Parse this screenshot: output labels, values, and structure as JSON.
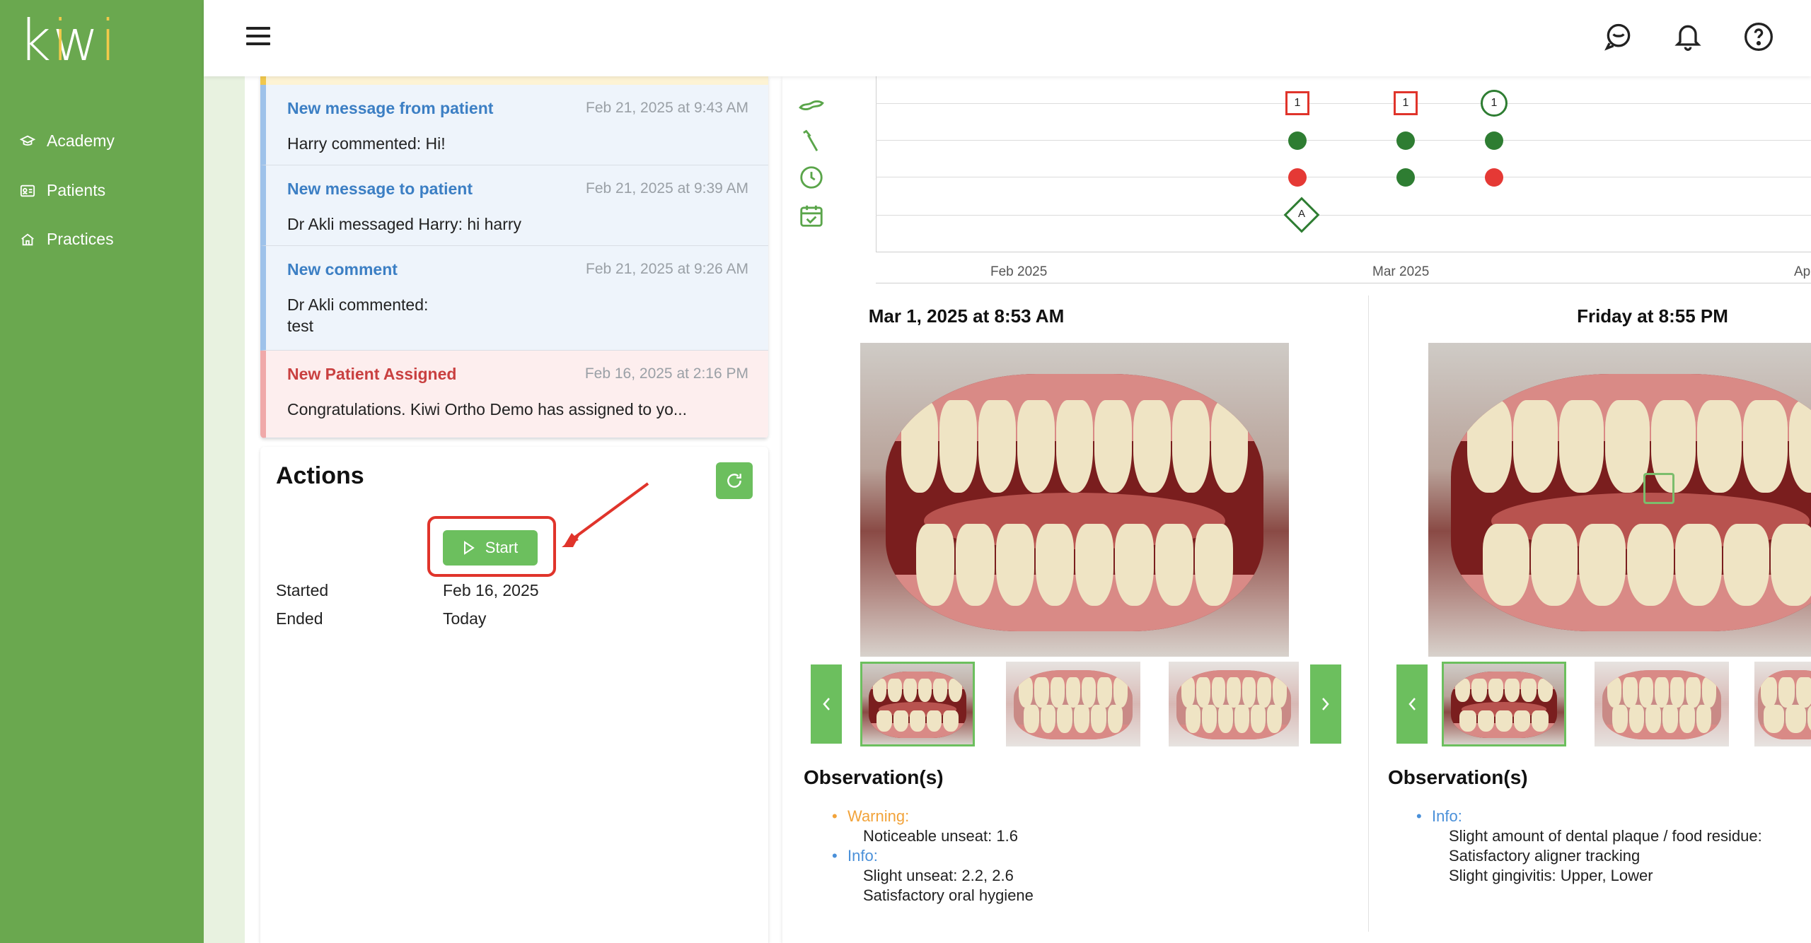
{
  "brand": {
    "logo_text": "kiwi"
  },
  "sidebar": {
    "items": [
      {
        "label": "Academy",
        "icon": "graduation-cap-icon"
      },
      {
        "label": "Patients",
        "icon": "id-card-icon"
      },
      {
        "label": "Practices",
        "icon": "home-icon"
      }
    ]
  },
  "topbar": {
    "icons": [
      "chat-icon",
      "bell-icon",
      "help-icon"
    ]
  },
  "notifications": [
    {
      "title": "New message from patient",
      "time": "Feb 21, 2025 at 9:43 AM",
      "body": "Harry commented: Hi!",
      "type": "blue"
    },
    {
      "title": "New message to patient",
      "time": "Feb 21, 2025 at 9:39 AM",
      "body": "Dr Akli messaged Harry: hi harry",
      "type": "blue"
    },
    {
      "title": "New comment",
      "time": "Feb 21, 2025 at 9:26 AM",
      "body": "Dr Akli commented:\ntest",
      "type": "blue"
    },
    {
      "title": "New Patient Assigned",
      "time": "Feb 16, 2025 at 2:16 PM",
      "body": "Congratulations. Kiwi Ortho Demo has assigned to yo...",
      "type": "red"
    }
  ],
  "actions": {
    "title": "Actions",
    "start_label": "Start",
    "started_label": "Started",
    "started_value": "Feb 16, 2025",
    "ended_label": "Ended",
    "ended_value": "Today"
  },
  "timeline": {
    "x_labels": [
      "Feb 2025",
      "Mar 2025",
      "Ap"
    ],
    "row_icons": [
      "aligner-icon",
      "toothbrush-icon",
      "clock-icon",
      "calendar-check-icon"
    ],
    "markers": {
      "square_1": "1",
      "square_2": "1",
      "circle_1": "1",
      "diamond": "A"
    }
  },
  "scans": [
    {
      "title": "Mar 1, 2025 at 8:53 AM",
      "observations_title": "Observation(s)",
      "warning_label": "Warning:",
      "warning_lines": [
        "Noticeable unseat: 1.6"
      ],
      "info_label": "Info:",
      "info_lines": [
        "Slight unseat: 2.2, 2.6",
        "Satisfactory oral hygiene"
      ]
    },
    {
      "title": "Friday at 8:55 PM",
      "observations_title": "Observation(s)",
      "info_label": "Info:",
      "info_lines": [
        "Slight amount of dental plaque / food residue:",
        "Satisfactory aligner tracking",
        "Slight gingivitis: Upper, Lower"
      ]
    }
  ],
  "colors": {
    "sidebar": "#6aa84f",
    "accent": "#6cbf5e",
    "highlight": "#e0342b",
    "warning": "#f2a33a",
    "info": "#4a90d9"
  }
}
